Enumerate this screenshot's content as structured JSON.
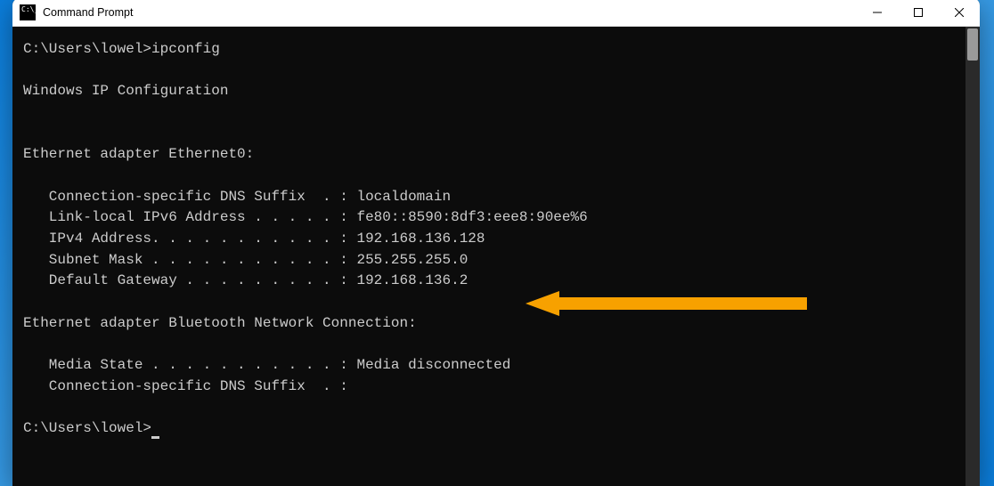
{
  "window": {
    "title": "Command Prompt"
  },
  "terminal": {
    "prompt1_path": "C:\\Users\\lowel>",
    "prompt1_cmd": "ipconfig",
    "header": "Windows IP Configuration",
    "adapter1": {
      "name": "Ethernet adapter Ethernet0:",
      "dns_suffix_label": "   Connection-specific DNS Suffix  . : ",
      "dns_suffix_value": "localdomain",
      "ipv6_label": "   Link-local IPv6 Address . . . . . : ",
      "ipv6_value": "fe80::8590:8df3:eee8:90ee%6",
      "ipv4_label": "   IPv4 Address. . . . . . . . . . . : ",
      "ipv4_value": "192.168.136.128",
      "subnet_label": "   Subnet Mask . . . . . . . . . . . : ",
      "subnet_value": "255.255.255.0",
      "gateway_label": "   Default Gateway . . . . . . . . . : ",
      "gateway_value": "192.168.136.2"
    },
    "adapter2": {
      "name": "Ethernet adapter Bluetooth Network Connection:",
      "media_label": "   Media State . . . . . . . . . . . : ",
      "media_value": "Media disconnected",
      "dns_suffix_label": "   Connection-specific DNS Suffix  . :",
      "dns_suffix_value": ""
    },
    "prompt2_path": "C:\\Users\\lowel>"
  },
  "annotation": {
    "arrow_target": "ipv4-address-highlight"
  }
}
